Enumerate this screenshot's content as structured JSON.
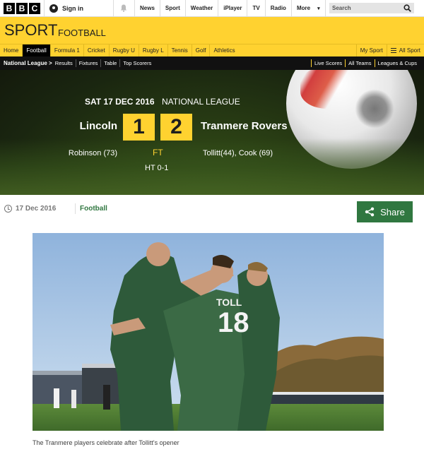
{
  "bbc_bar": {
    "logo_letters": [
      "B",
      "B",
      "C"
    ],
    "signin_label": "Sign in",
    "nav": [
      "News",
      "Sport",
      "Weather",
      "iPlayer",
      "TV",
      "Radio",
      "More"
    ],
    "more_chevron": "▾",
    "search_placeholder": "Search"
  },
  "sport_header": {
    "title": "SPORT",
    "section": "FOOTBALL"
  },
  "sport_nav": {
    "items": [
      "Home",
      "Football",
      "Formula 1",
      "Cricket",
      "Rugby U",
      "Rugby L",
      "Tennis",
      "Golf",
      "Athletics"
    ],
    "active": "Football",
    "right": [
      "My Sport",
      "All Sport"
    ]
  },
  "sub_nav": {
    "lead": "National League >",
    "items": [
      "Results",
      "Fixtures",
      "Table",
      "Top Scorers"
    ],
    "right": [
      "Live Scores",
      "All Teams",
      "Leagues & Cups"
    ]
  },
  "match": {
    "date": "SAT 17 DEC 2016",
    "competition": "NATIONAL LEAGUE",
    "home_team": "Lincoln",
    "away_team": "Tranmere Rovers",
    "home_score": "1",
    "away_score": "2",
    "status": "FT",
    "home_scorers": "Robinson (73)",
    "away_scorers": "Tollitt(44), Cook (69)",
    "half_time": "HT 0-1"
  },
  "article": {
    "date": "17 Dec 2016",
    "section_link": "Football",
    "share_label": "Share",
    "photo_caption": "The Tranmere players celebrate after Tollitt's opener",
    "photo_shirt_text": "TOLL",
    "photo_shirt_number": "18"
  },
  "colors": {
    "sport_yellow": "#ffd230",
    "share_green": "#307740",
    "nav_black": "#111111"
  },
  "icons": [
    "user-icon",
    "bell-icon",
    "search-icon",
    "menu-icon",
    "clock-icon",
    "share-icon"
  ]
}
